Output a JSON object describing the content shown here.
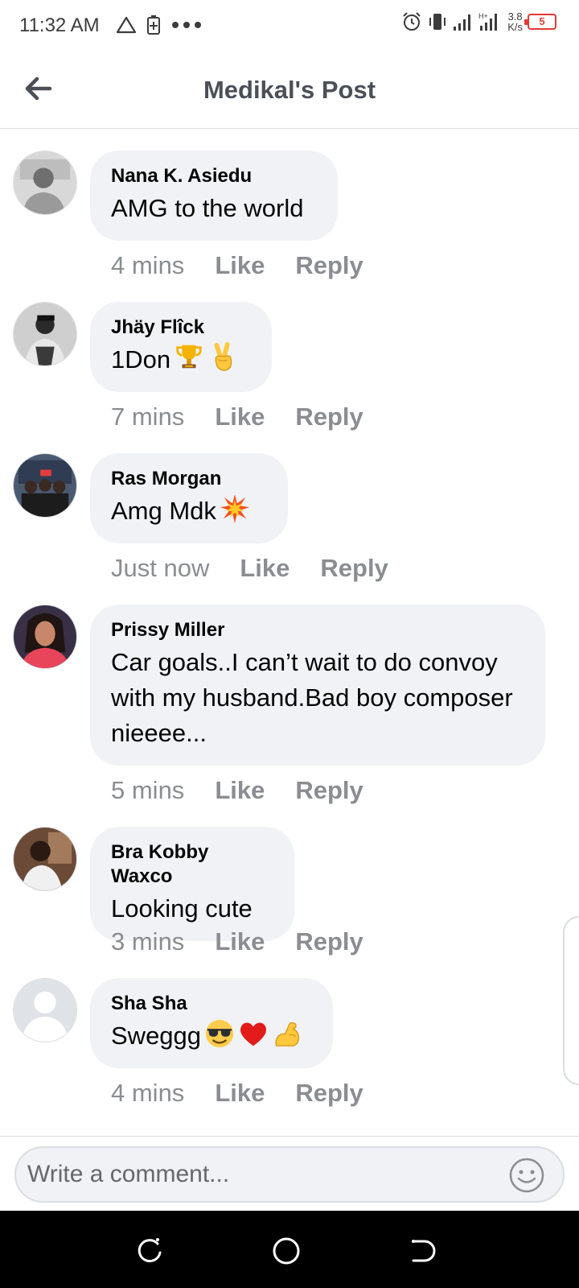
{
  "status_bar": {
    "time": "11:32 AM",
    "speed_value": "3.8",
    "speed_unit": "K/s",
    "battery": "5",
    "icons": [
      "warning-icon",
      "battery-saver-icon",
      "more-icon",
      "alarm-icon",
      "vibrate-icon",
      "signal-icon",
      "hplus-signal-icon"
    ]
  },
  "header": {
    "title": "Medikal's Post",
    "back_icon": "back-arrow-icon"
  },
  "comments": [
    {
      "author": "Nana K. Asiedu",
      "text": "AMG to the world",
      "emojis": [],
      "time": "4 mins",
      "like": "Like",
      "reply": "Reply"
    },
    {
      "author": "Jhäy Flîck",
      "text": "1Don",
      "emojis": [
        "trophy",
        "victory-hand"
      ],
      "time": "7 mins",
      "like": "Like",
      "reply": "Reply"
    },
    {
      "author": "Ras Morgan",
      "text": "Amg Mdk",
      "emojis": [
        "collision"
      ],
      "time": "Just now",
      "like": "Like",
      "reply": "Reply"
    },
    {
      "author": "Prissy Miller",
      "text": "Car goals..I can’t wait to do convoy with my husband.Bad boy composer nieeee...",
      "emojis": [],
      "time": "5 mins",
      "like": "Like",
      "reply": "Reply"
    },
    {
      "author": "Bra Kobby Waxco",
      "text": "Looking cute",
      "emojis": [],
      "time": "3 mins",
      "like": "Like",
      "reply": "Reply"
    },
    {
      "author": "Sha Sha",
      "text": "Sweggg",
      "emojis": [
        "sunglasses-face",
        "red-heart",
        "flexed-biceps"
      ],
      "time": "4 mins",
      "like": "Like",
      "reply": "Reply"
    }
  ],
  "composer": {
    "placeholder": "Write a comment...",
    "value": "",
    "emoji_icon": "smiley-icon"
  },
  "nav_bar": {
    "icons": [
      "recents-icon",
      "home-icon",
      "back-icon"
    ]
  },
  "colors": {
    "bubble": "#f0f2f5",
    "meta_text": "#8a8d91",
    "title": "#4b4f56",
    "battery_alert": "#e53935",
    "nav_bar": "#000000"
  }
}
